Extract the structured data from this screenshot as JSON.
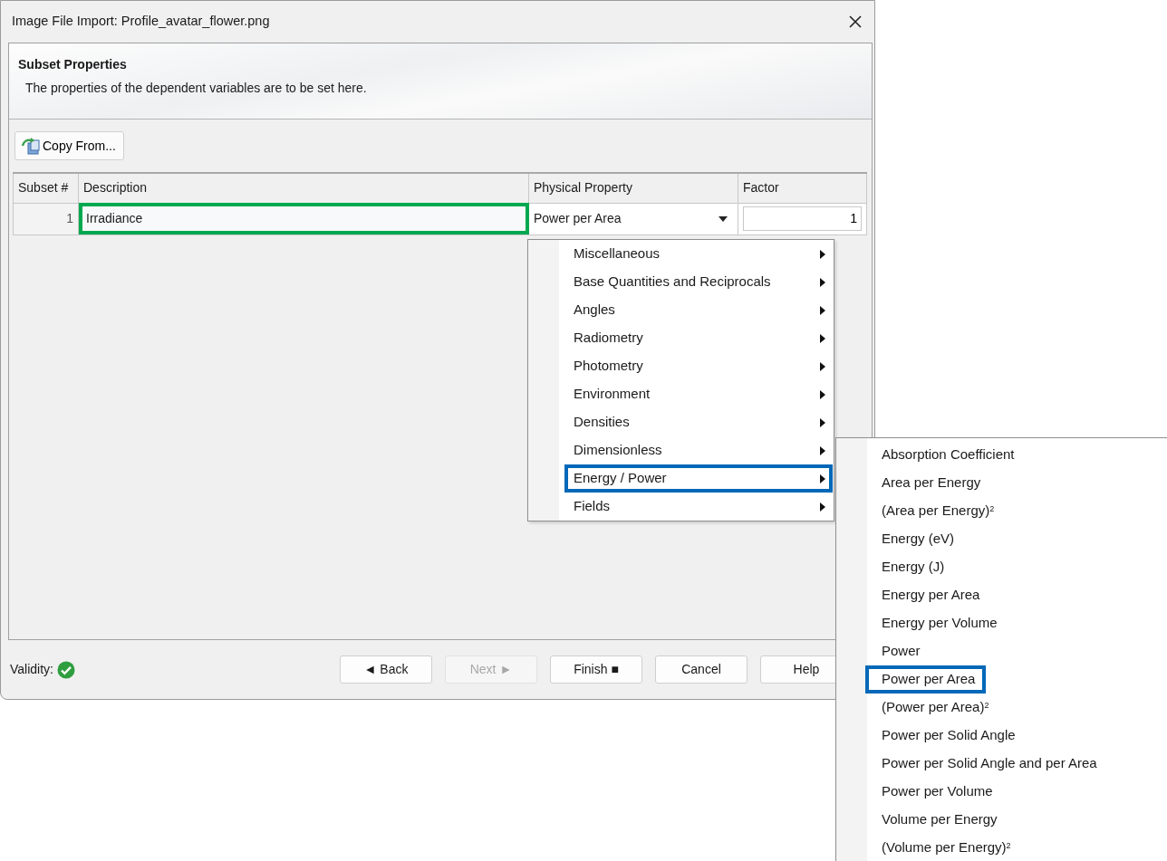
{
  "window": {
    "title": "Image File Import: Profile_avatar_flower.png"
  },
  "header": {
    "title": "Subset Properties",
    "subtitle": "The properties of the dependent variables are to be set here."
  },
  "toolbar": {
    "copy_button": "Copy From..."
  },
  "table": {
    "columns": [
      "Subset #",
      "Description",
      "Physical Property",
      "Factor"
    ],
    "rows": [
      {
        "subset": "1",
        "description": "Irradiance",
        "highlighted": true,
        "physical_property": "Power per Area",
        "factor": "1"
      }
    ]
  },
  "menu": {
    "items": [
      {
        "label": "Miscellaneous",
        "highlighted": false
      },
      {
        "label": "Base Quantities and Reciprocals",
        "highlighted": false
      },
      {
        "label": "Angles",
        "highlighted": false
      },
      {
        "label": "Radiometry",
        "highlighted": false
      },
      {
        "label": "Photometry",
        "highlighted": false
      },
      {
        "label": "Environment",
        "highlighted": false
      },
      {
        "label": "Densities",
        "highlighted": false
      },
      {
        "label": "Dimensionless",
        "highlighted": false
      },
      {
        "label": "Energy / Power",
        "highlighted": true
      },
      {
        "label": "Fields",
        "highlighted": false
      }
    ]
  },
  "submenu": {
    "items": [
      {
        "label": "Absorption Coefficient",
        "highlighted": false
      },
      {
        "label": "Area per Energy",
        "highlighted": false
      },
      {
        "label": "(Area per Energy)$^{2}$",
        "highlighted": false
      },
      {
        "label": "Energy (eV)",
        "highlighted": false
      },
      {
        "label": "Energy (J)",
        "highlighted": false
      },
      {
        "label": "Energy per Area",
        "highlighted": false
      },
      {
        "label": "Energy per Volume",
        "highlighted": false
      },
      {
        "label": "Power",
        "highlighted": false
      },
      {
        "label": "Power per Area",
        "highlighted": true
      },
      {
        "label": "(Power per Area)$^{2}$",
        "highlighted": false
      },
      {
        "label": "Power per Solid Angle",
        "highlighted": false
      },
      {
        "label": "Power per Solid Angle and per Area",
        "highlighted": false
      },
      {
        "label": "Power per Volume",
        "highlighted": false
      },
      {
        "label": "Volume per Energy",
        "highlighted": false
      },
      {
        "label": "(Volume per Energy)$^{2}$",
        "highlighted": false
      }
    ]
  },
  "footer": {
    "validity_label": "Validity:",
    "buttons": [
      {
        "label": "◄ Back",
        "disabled": false
      },
      {
        "label": "Next ►",
        "disabled": true
      },
      {
        "label": "Finish ■",
        "disabled": false
      },
      {
        "label": "Cancel",
        "disabled": false
      },
      {
        "label": "Help",
        "disabled": false
      }
    ]
  }
}
